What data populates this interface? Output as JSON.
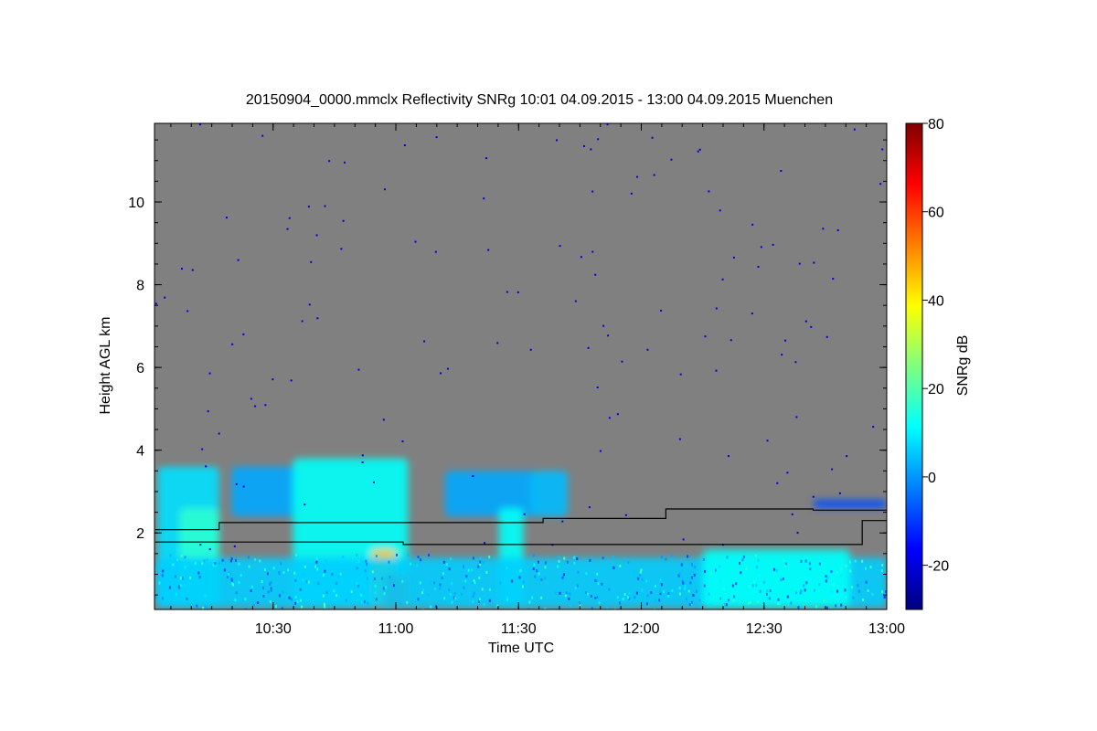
{
  "chart_data": {
    "type": "heatmap",
    "title": "20150904_0000.mmclx Reflectivity SNRg   10:01 04.09.2015 - 13:00 04.09.2015 Muenchen",
    "xlabel": "Time UTC",
    "ylabel": "Height AGL km",
    "colorbar_label": "SNRg dB",
    "xlim": [
      "10:01",
      "13:00"
    ],
    "x_ticks": [
      "10:30",
      "11:00",
      "11:30",
      "12:00",
      "12:30",
      "13:00"
    ],
    "ylim": [
      0.15,
      11.9
    ],
    "y_ticks": [
      2,
      4,
      6,
      8,
      10
    ],
    "colorbar_range": [
      -30,
      80
    ],
    "colorbar_ticks": [
      -20,
      0,
      20,
      40,
      60,
      80
    ],
    "colormap": [
      "#00007f",
      "#0000ff",
      "#007fff",
      "#00ffff",
      "#7fff7f",
      "#ffff00",
      "#ff7f00",
      "#ff0000",
      "#7f0000"
    ],
    "background_color": "#808080",
    "echo_regions": [
      {
        "t": [
          10.03,
          10.28
        ],
        "h": [
          0.2,
          3.6
        ],
        "snr": 8
      },
      {
        "t": [
          10.12,
          10.28
        ],
        "h": [
          0.3,
          2.6
        ],
        "snr": 16
      },
      {
        "t": [
          10.33,
          10.6
        ],
        "h": [
          2.4,
          3.6
        ],
        "snr": 2
      },
      {
        "t": [
          10.58,
          11.05
        ],
        "h": [
          0.2,
          3.8
        ],
        "snr": 12
      },
      {
        "t": [
          10.9,
          11.0
        ],
        "h": [
          0.2,
          1.6
        ],
        "snr": 45
      },
      {
        "t": [
          10.95,
          11.05
        ],
        "h": [
          0.2,
          1.0
        ],
        "snr": 62
      },
      {
        "t": [
          11.2,
          11.57
        ],
        "h": [
          2.4,
          3.5
        ],
        "snr": 2
      },
      {
        "t": [
          11.42,
          11.52
        ],
        "h": [
          0.2,
          2.6
        ],
        "snr": 12
      },
      {
        "t": [
          11.55,
          11.7
        ],
        "h": [
          2.4,
          3.5
        ],
        "snr": 4
      },
      {
        "t": [
          10.02,
          13.0
        ],
        "h": [
          0.2,
          1.4
        ],
        "snr": 6
      },
      {
        "t": [
          12.25,
          12.85
        ],
        "h": [
          0.2,
          1.6
        ],
        "snr": 12
      },
      {
        "t": [
          12.7,
          13.0
        ],
        "h": [
          2.6,
          2.8
        ],
        "snr": -8
      }
    ],
    "black_lines": [
      {
        "points": [
          [
            10.02,
            2.08
          ],
          [
            10.28,
            2.08
          ],
          [
            10.28,
            2.25
          ],
          [
            11.6,
            2.25
          ],
          [
            11.6,
            2.35
          ],
          [
            12.1,
            2.35
          ],
          [
            12.1,
            2.58
          ],
          [
            12.7,
            2.58
          ],
          [
            12.7,
            2.55
          ],
          [
            13.0,
            2.55
          ]
        ]
      },
      {
        "points": [
          [
            10.02,
            1.78
          ],
          [
            11.03,
            1.78
          ],
          [
            11.03,
            1.72
          ],
          [
            12.9,
            1.72
          ],
          [
            12.9,
            2.3
          ],
          [
            13.0,
            2.3
          ]
        ]
      }
    ]
  }
}
